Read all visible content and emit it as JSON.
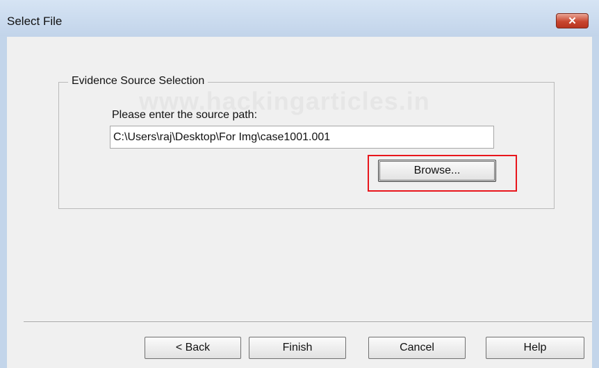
{
  "window": {
    "title": "Select File",
    "close_label": "✕"
  },
  "group": {
    "label": "Evidence Source Selection",
    "watermark": "www.hackingarticles.in"
  },
  "source": {
    "prompt": "Please enter the source path:",
    "path_value": "C:\\Users\\raj\\Desktop\\For Img\\case1001.001",
    "browse_label": "Browse..."
  },
  "buttons": {
    "back": "< Back",
    "finish": "Finish",
    "cancel": "Cancel",
    "help": "Help"
  },
  "colors": {
    "highlight": "#e8151b",
    "close_button": "#c8462f"
  }
}
